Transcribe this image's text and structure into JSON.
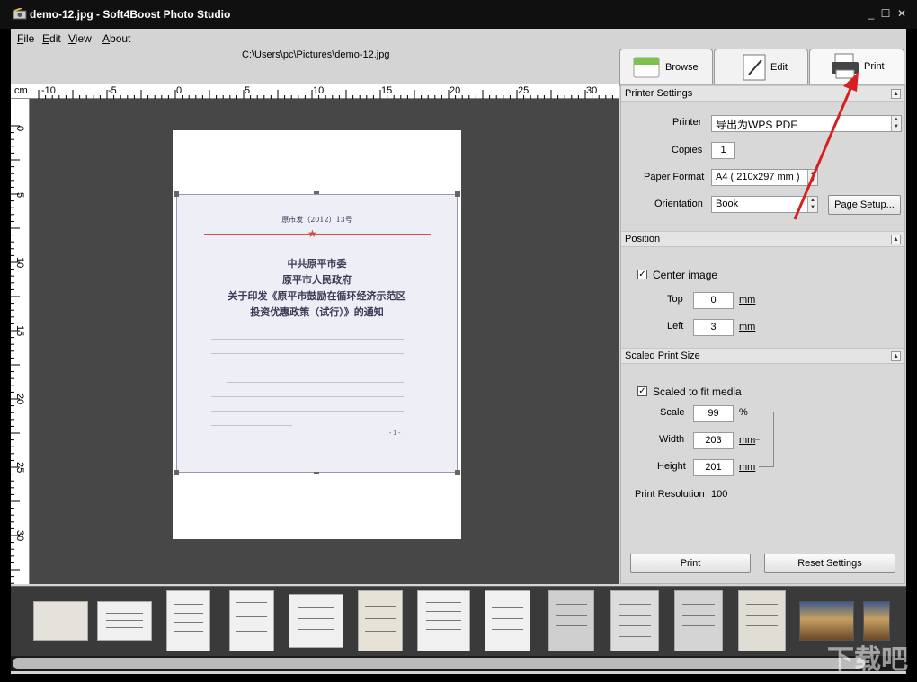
{
  "window": {
    "title": "demo-12.jpg  -  Soft4Boost Photo Studio",
    "controls": {
      "minimize": "_",
      "maximize": "☐",
      "close": "✕"
    }
  },
  "menu": [
    {
      "label": "File",
      "mnemonic": "F",
      "rest": "ile"
    },
    {
      "label": "Edit",
      "mnemonic": "E",
      "rest": "dit"
    },
    {
      "label": "View",
      "mnemonic": "V",
      "rest": "iew"
    },
    {
      "label": "About",
      "mnemonic": "A",
      "rest": "bout"
    }
  ],
  "file_path": "C:\\Users\\pc\\Pictures\\demo-12.jpg",
  "tabs": {
    "browse": "Browse",
    "edit": "Edit",
    "print": "Print",
    "active": "print"
  },
  "ruler": {
    "unit": "cm",
    "h_labels": [
      "-10",
      "-5",
      "0",
      "5",
      "10",
      "15",
      "20",
      "25",
      "30"
    ],
    "v_labels": [
      "0",
      "5",
      "10",
      "15",
      "20",
      "25",
      "30"
    ]
  },
  "document": {
    "ref": "原市发（2012）13号",
    "title_lines": [
      "中共原平市委",
      "原平市人民政府",
      "关于印发《原平市鼓励在循环经济示范区",
      "投资优惠政策（试行）》的通知"
    ],
    "page_number": "- 1 -"
  },
  "printer_settings": {
    "header": "Printer Settings",
    "printer_label": "Printer",
    "printer_value": "导出为WPS PDF",
    "copies_label": "Copies",
    "copies_value": "1",
    "paper_label": "Paper Format",
    "paper_value": "A4 ( 210x297 mm )",
    "orientation_label": "Orientation",
    "orientation_value": "Book",
    "page_setup": "Page Setup..."
  },
  "position": {
    "header": "Position",
    "center_label": "Center image",
    "center_checked": true,
    "top_label": "Top",
    "top_value": "0",
    "left_label": "Left",
    "left_value": "3",
    "unit": "mm"
  },
  "scaled": {
    "header": "Scaled Print Size",
    "fit_label": "Scaled to fit media",
    "fit_checked": true,
    "scale_label": "Scale",
    "scale_value": "99",
    "scale_unit": "%",
    "width_label": "Width",
    "width_value": "203",
    "height_label": "Height",
    "height_value": "201",
    "unit": "mm",
    "resolution_label": "Print Resolution",
    "resolution_value": "100"
  },
  "buttons": {
    "print": "Print",
    "reset": "Reset Settings"
  },
  "icons": {
    "app": "photo-camera-icon",
    "collapse": "collapse-up-icon"
  },
  "thumbnail_count": 14,
  "watermark": "下载吧"
}
